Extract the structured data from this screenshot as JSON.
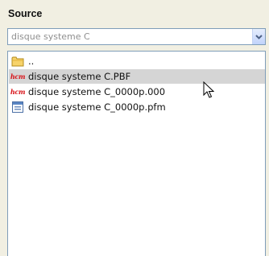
{
  "panel": {
    "title": "Source"
  },
  "combo": {
    "value": "disque systeme C",
    "arrow_icon": "chevron-down-icon"
  },
  "files": [
    {
      "label": "..",
      "icon": "folder-icon",
      "selected": false
    },
    {
      "label": "disque systeme C.PBF",
      "icon": "hcm-file-icon",
      "icon_text": "hcm",
      "selected": true
    },
    {
      "label": "disque systeme C_0000p.000",
      "icon": "hcm-file-icon",
      "icon_text": "hcm",
      "selected": false
    },
    {
      "label": "disque systeme C_0000p.pfm",
      "icon": "pfm-file-icon",
      "selected": false
    }
  ],
  "colors": {
    "hcm_icon": "#d8141a",
    "selection": "#d5d5d5",
    "border": "#7f9db9"
  }
}
